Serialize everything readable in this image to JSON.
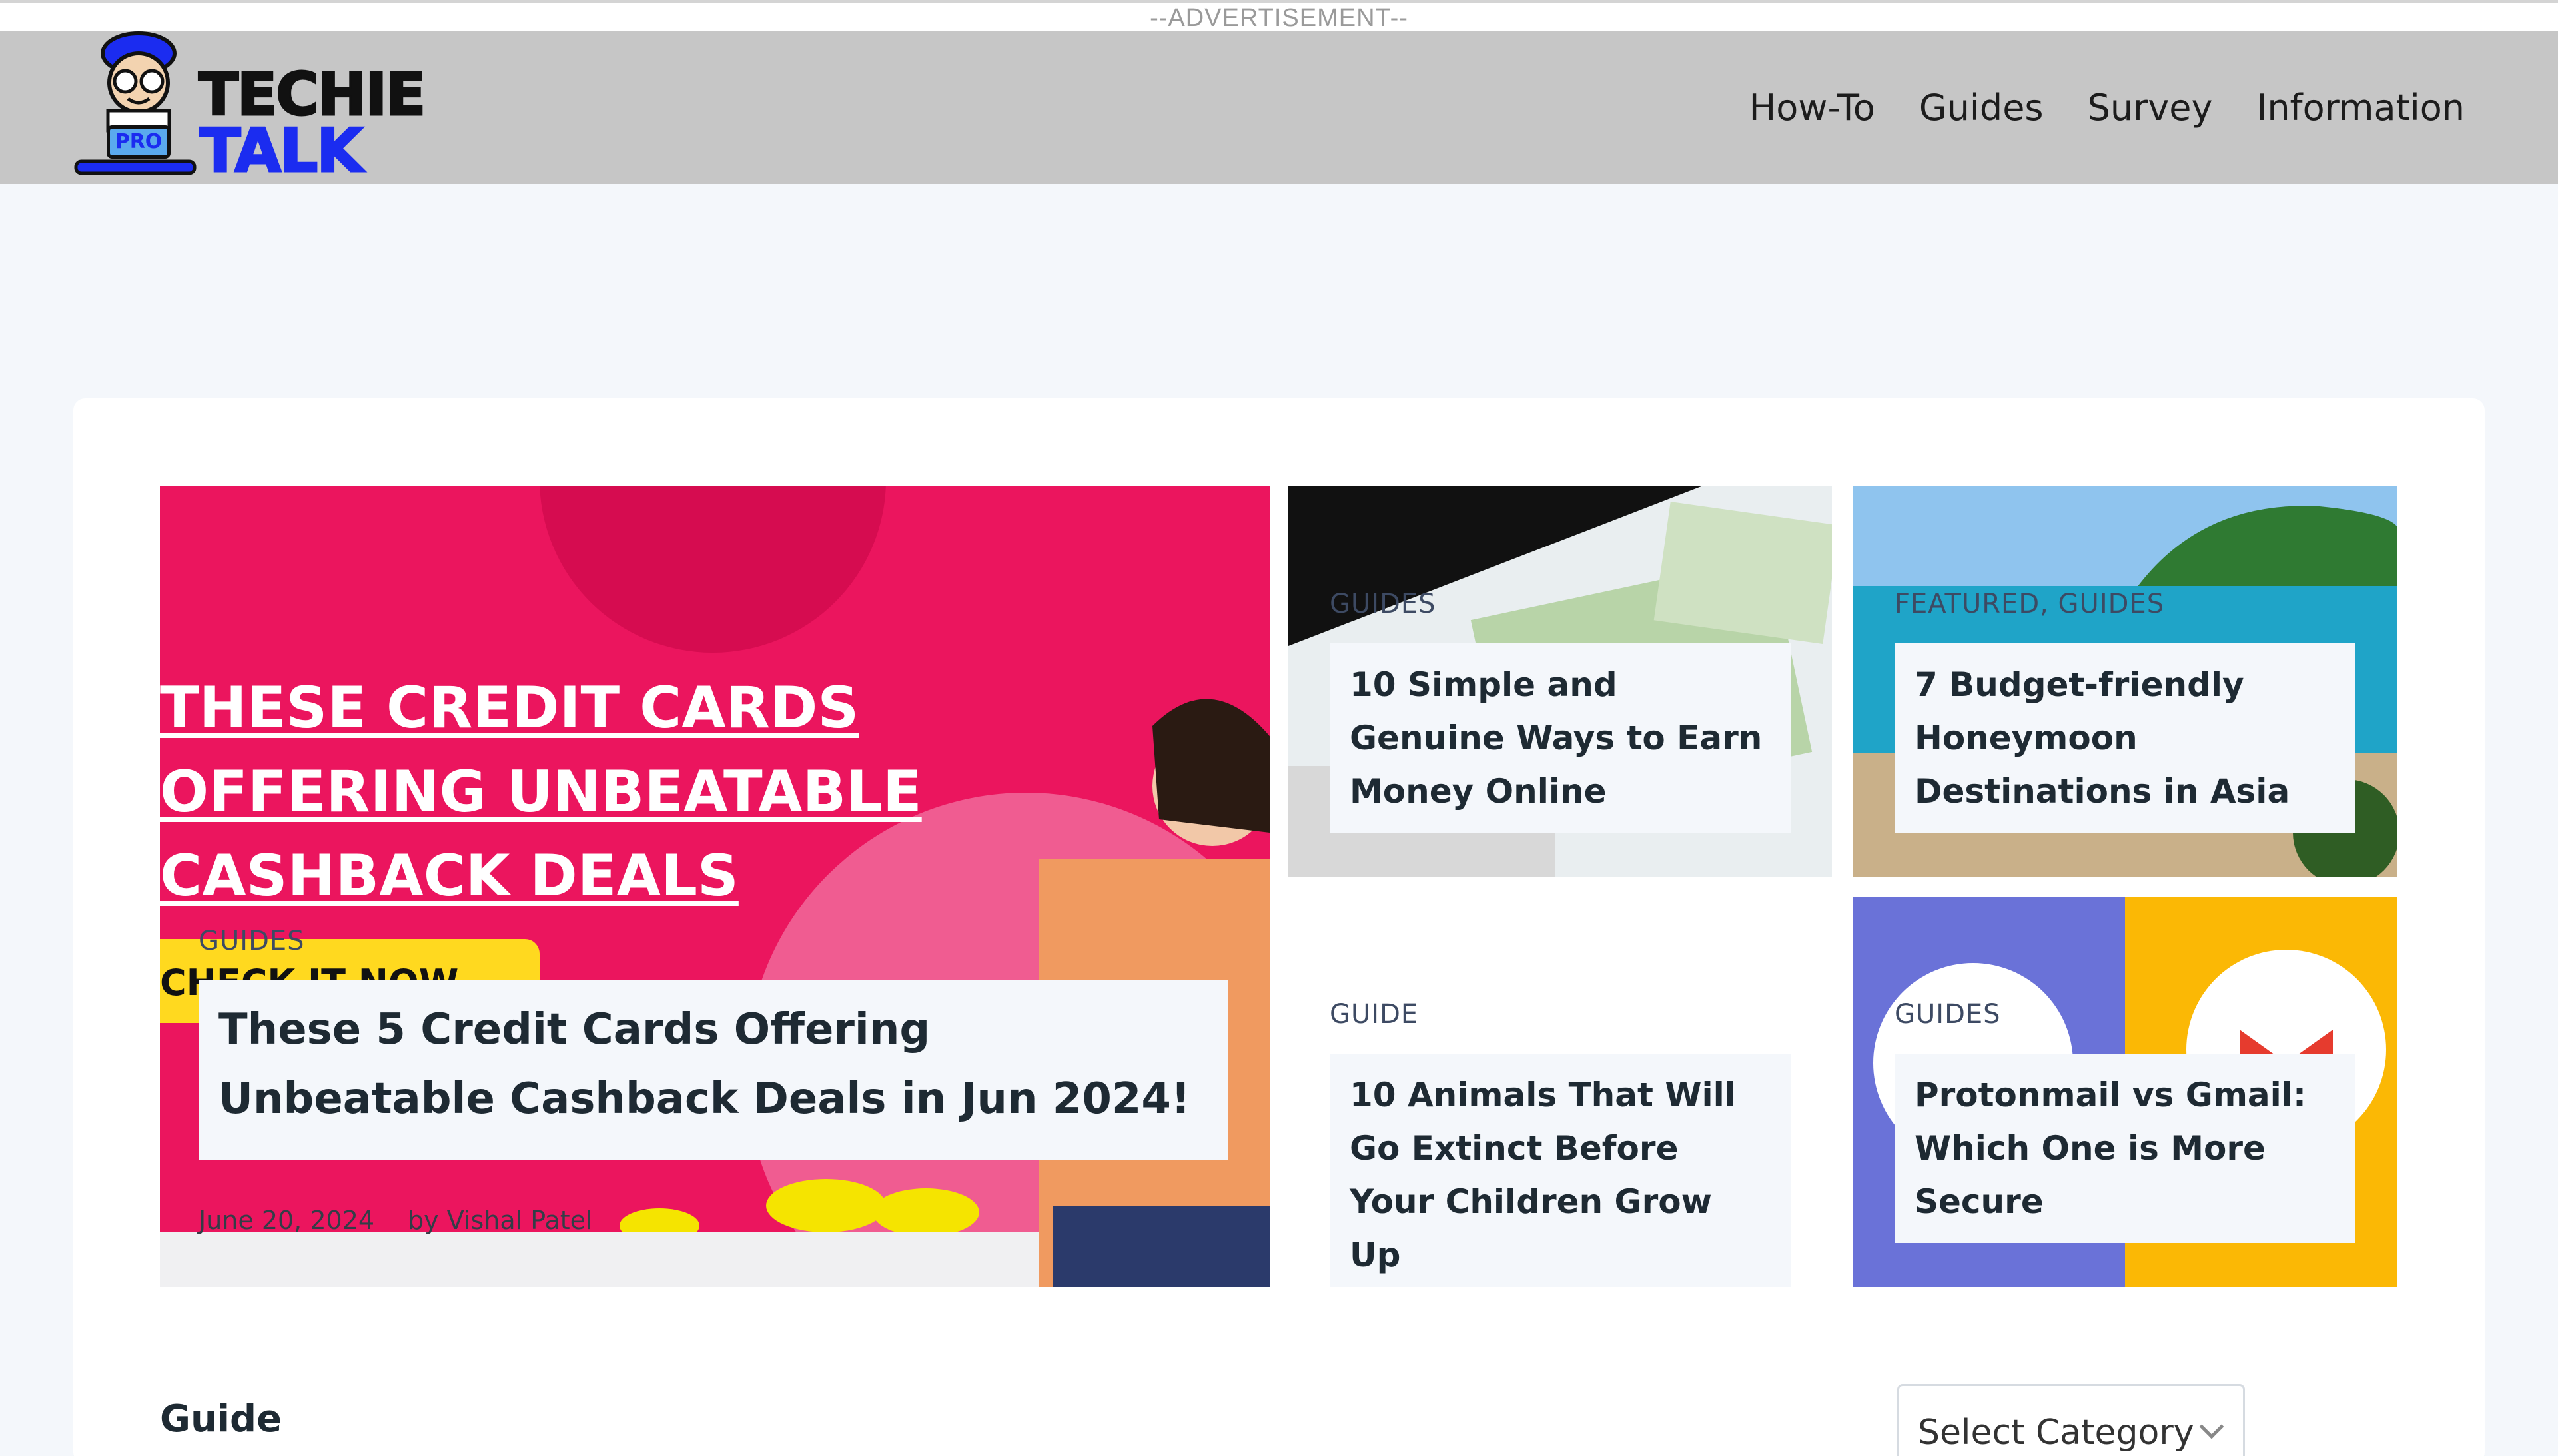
{
  "ad": {
    "label": "--ADVERTISEMENT--"
  },
  "header": {
    "logo": {
      "line1": "TECHIE",
      "line2": "TALK",
      "badge": "PRO"
    },
    "nav": [
      "How-To",
      "Guides",
      "Survey",
      "Information"
    ]
  },
  "featured": {
    "hero": {
      "headline": "THESE CREDIT CARDS OFFERING UNBEATABLE CASHBACK DEALS",
      "cta": "CHECK IT NOW",
      "category": "GUIDES",
      "title": "These 5 Credit Cards Offering Unbeatable Cashback Deals in Jun 2024!",
      "date": "June 20, 2024",
      "author": "by Vishal Patel"
    },
    "tiles": [
      {
        "category": "GUIDES",
        "title": "10 Simple and Genuine Ways to Earn Money Online"
      },
      {
        "category": "FEATURED, GUIDES",
        "title": "7 Budget-friendly Honeymoon Destinations in Asia"
      },
      {
        "category": "GUIDE",
        "title": "10 Animals That Will Go Extinct Before Your Children Grow Up"
      },
      {
        "category": "GUIDES",
        "title": "Protonmail vs Gmail: Which One is More Secure"
      }
    ]
  },
  "section": {
    "title": "Guide",
    "select_label": "Select Category"
  },
  "colors": {
    "header_bg": "#c6c6c6",
    "hero_pink": "#eb155e",
    "brand_blue": "#1b2cf0"
  }
}
